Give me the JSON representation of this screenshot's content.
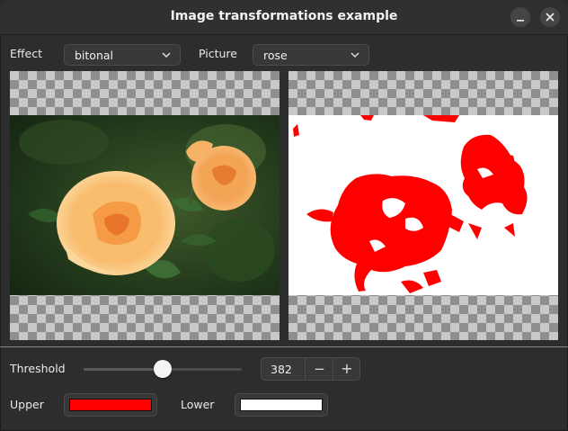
{
  "window": {
    "title": "Image transformations example"
  },
  "controls": {
    "effect_label": "Effect",
    "effect_value": "bitonal",
    "picture_label": "Picture",
    "picture_value": "rose",
    "threshold_label": "Threshold",
    "threshold_value": "382",
    "threshold_fraction": 0.5,
    "minus_symbol": "−",
    "plus_symbol": "+",
    "upper_label": "Upper",
    "upper_color": "#ff0000",
    "lower_label": "Lower",
    "lower_color": "#ffffff"
  },
  "icons": {
    "minimize": "minimize-icon",
    "close": "close-icon",
    "dropdown": "chevron-down-icon"
  }
}
